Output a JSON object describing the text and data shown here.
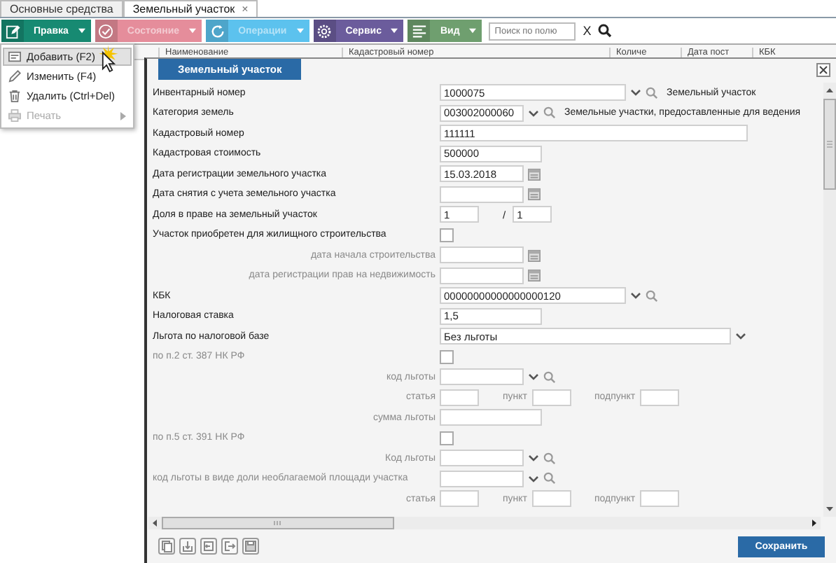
{
  "tabs": [
    {
      "label": "Основные средства",
      "selected": false
    },
    {
      "label": "Земельный участок",
      "selected": true,
      "close": "×"
    }
  ],
  "toolbar": {
    "buttons": [
      {
        "label": "Правка",
        "color": "#178a72",
        "disabled": false
      },
      {
        "label": "Состояние",
        "color": "#e58d9b",
        "disabled": true
      },
      {
        "label": "Операции",
        "color": "#5cc2ee",
        "disabled": true
      },
      {
        "label": "Сервис",
        "color": "#6b5c9c",
        "disabled": false
      },
      {
        "label": "Вид",
        "color": "#6f9f6f",
        "disabled": false
      }
    ],
    "search": {
      "placeholder": "Поиск по полю",
      "clear": "X"
    }
  },
  "table": {
    "columns": [
      "Наименование",
      "Кадастровый номер",
      "Количе",
      "Дата пост",
      "КБК"
    ]
  },
  "menu": {
    "items": [
      {
        "label": "Добавить (F2)",
        "selected": true,
        "disabled": false,
        "submenu": false
      },
      {
        "label": "Изменить (F4)",
        "selected": false,
        "disabled": false,
        "submenu": false
      },
      {
        "label": "Удалить (Ctrl+Del)",
        "selected": false,
        "disabled": false,
        "submenu": false
      },
      {
        "label": "Печать",
        "selected": false,
        "disabled": true,
        "submenu": true
      }
    ]
  },
  "dialog": {
    "title": "Земельный участок",
    "rows": [
      {
        "kind": "lookup",
        "label": "Инвентарный номер",
        "value": "1000075",
        "aux": "Земельный участок",
        "muted": false,
        "sub": false
      },
      {
        "kind": "code",
        "label": "Категория земель",
        "value": "003002000060",
        "aux": "Земельные участки, предоставленные для ведения",
        "muted": false,
        "sub": false
      },
      {
        "kind": "text",
        "label": "Кадастровый номер",
        "value": "111111",
        "muted": false,
        "sub": false
      },
      {
        "kind": "number",
        "label": "Кадастровая стоимость",
        "value": "500000",
        "muted": false,
        "sub": false
      },
      {
        "kind": "date",
        "label": "Дата регистрации земельного участка",
        "value": "15.03.2018",
        "muted": false,
        "sub": false
      },
      {
        "kind": "date",
        "label": "Дата снятия с учета земельного участка",
        "muted": false,
        "sub": false
      },
      {
        "kind": "share",
        "label": "Доля в праве на земельный участок",
        "value": "1",
        "separator": "/",
        "denominator": "1",
        "muted": false,
        "sub": false
      },
      {
        "kind": "checkbox",
        "label": "Участок приобретен для жилищного строительства",
        "checked": false,
        "muted": false,
        "sub": false
      },
      {
        "kind": "date",
        "label": "дата начала строительства",
        "muted": true,
        "sub": true
      },
      {
        "kind": "date",
        "label": "дата регистрации прав на недвижимость",
        "muted": true,
        "sub": true
      },
      {
        "kind": "lookup",
        "label": "КБК",
        "value": "00000000000000000120",
        "muted": false,
        "sub": false
      },
      {
        "kind": "number",
        "label": "Налоговая ставка",
        "value": "1,5",
        "muted": false,
        "sub": false
      },
      {
        "kind": "select",
        "label": "Льгота по налоговой базе",
        "value": "Без льготы",
        "muted": false,
        "sub": false
      },
      {
        "kind": "checkbox",
        "label": "по п.2 ст. 387 НК РФ",
        "checked": false,
        "muted": true,
        "sub": false
      },
      {
        "kind": "code",
        "label": "код льготы",
        "muted": true,
        "sub": true
      },
      {
        "kind": "clause",
        "label": "статья",
        "parts": [
          "пункт",
          "подпункт"
        ],
        "muted": true,
        "sub": true
      },
      {
        "kind": "number",
        "label": "сумма льготы",
        "muted": true,
        "sub": true
      },
      {
        "kind": "checkbox",
        "label": "по п.5 ст. 391 НК РФ",
        "checked": false,
        "muted": true,
        "sub": false
      },
      {
        "kind": "code",
        "label": "Код льготы",
        "muted": true,
        "sub": true
      },
      {
        "kind": "code",
        "label": "код льготы в виде доли необлагаемой площади участка",
        "muted": true,
        "sub": false
      },
      {
        "kind": "clause",
        "label": "статья",
        "parts": [
          "пункт",
          "подпункт"
        ],
        "muted": true,
        "sub": true
      }
    ],
    "save_button": "Сохранить"
  }
}
